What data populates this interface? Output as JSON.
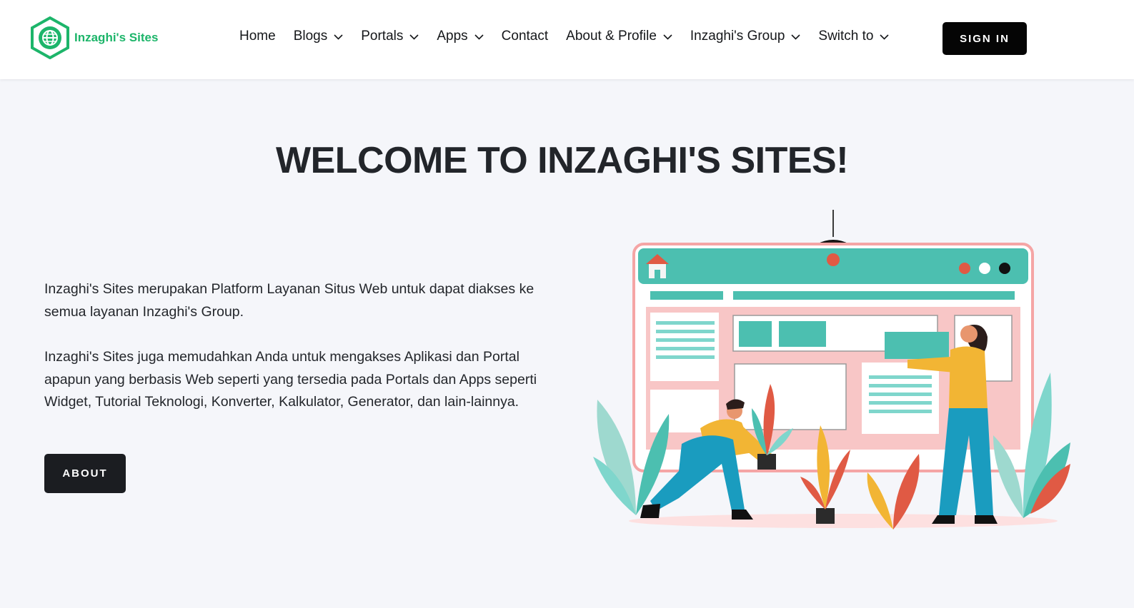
{
  "brand": {
    "name": "Inzaghi's Sites",
    "color": "#1db56a",
    "icon": "globe-hexagon-icon"
  },
  "nav": {
    "items": [
      {
        "label": "Home",
        "dropdown": false
      },
      {
        "label": "Blogs",
        "dropdown": true
      },
      {
        "label": "Portals",
        "dropdown": true
      },
      {
        "label": "Apps",
        "dropdown": true
      },
      {
        "label": "Contact",
        "dropdown": false
      },
      {
        "label": "About & Profile",
        "dropdown": true
      },
      {
        "label": "Inzaghi's Group",
        "dropdown": true
      },
      {
        "label": "Switch to",
        "dropdown": true
      }
    ],
    "signin_label": "SIGN IN"
  },
  "hero": {
    "title": "WELCOME TO INZAGHI'S SITES!",
    "paragraph1": "Inzaghi's Sites merupakan Platform Layanan Situs Web untuk dapat diakses ke semua layanan Inzaghi's Group.",
    "paragraph2": "Inzaghi's Sites juga memudahkan Anda untuk mengakses Aplikasi dan Portal apapun yang berbasis Web seperti yang tersedia pada Portals dan Apps seperti Widget, Tutorial Teknologi, Konverter, Kalkulator, Generator, dan lain-lainnya.",
    "about_label": "ABOUT"
  },
  "colors": {
    "accent": "#1db56a",
    "button_dark": "#050505",
    "illustration_teal": "#4cbfb0",
    "illustration_pink": "#f8c6c6",
    "illustration_yellow": "#f2b534",
    "illustration_blue": "#1a9cbf",
    "illustration_red": "#e05a44"
  }
}
